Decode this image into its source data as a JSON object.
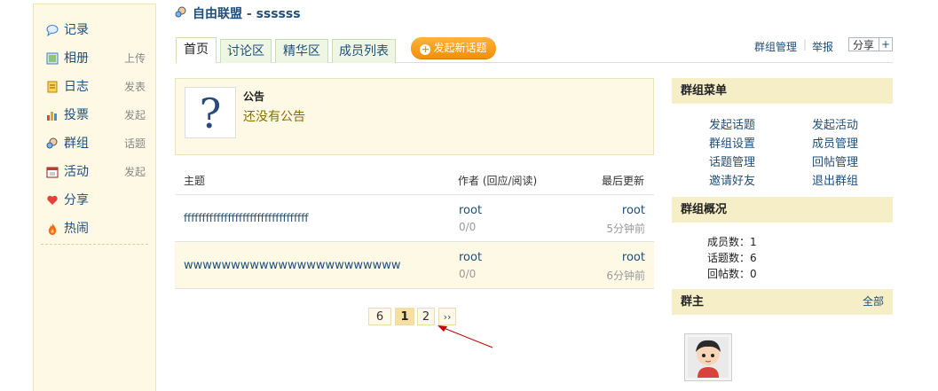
{
  "sidebar": {
    "items": [
      {
        "label": "记录",
        "action": "",
        "icon": "speech-bubble-icon"
      },
      {
        "label": "相册",
        "action": "上传",
        "icon": "photo-icon"
      },
      {
        "label": "日志",
        "action": "发表",
        "icon": "notebook-icon"
      },
      {
        "label": "投票",
        "action": "发起",
        "icon": "bar-chart-icon"
      },
      {
        "label": "群组",
        "action": "话题",
        "icon": "group-icon"
      },
      {
        "label": "活动",
        "action": "发起",
        "icon": "calendar-icon"
      },
      {
        "label": "分享",
        "action": "",
        "icon": "heart-icon"
      },
      {
        "label": "热闹",
        "action": "",
        "icon": "fire-icon"
      }
    ]
  },
  "header": {
    "group_name": "自由联盟",
    "separator": "-",
    "subtitle": "ssssss"
  },
  "tabs": [
    {
      "label": "首页",
      "active": true
    },
    {
      "label": "讨论区",
      "active": false
    },
    {
      "label": "精华区",
      "active": false
    },
    {
      "label": "成员列表",
      "active": false
    }
  ],
  "new_topic_label": "发起新话题",
  "top_links": {
    "manage": "群组管理",
    "report": "举报",
    "share": "分享",
    "share_plus": "+"
  },
  "announcement": {
    "title": "公告",
    "text": "还没有公告",
    "image_glyph": "?"
  },
  "topic_table": {
    "headers": {
      "subject": "主题",
      "author": "作者 (回应/阅读)",
      "last": "最后更新"
    },
    "rows": [
      {
        "subject": "ffffffffffffffffffffffffffffffffff",
        "author": "root",
        "stats": "0/0",
        "last_user": "root",
        "last_time": "5分钟前"
      },
      {
        "subject": "wwwwwwwwwwwwwwwwwwwwwww",
        "author": "root",
        "stats": "0/0",
        "last_user": "root",
        "last_time": "6分钟前"
      }
    ]
  },
  "pagination": {
    "pages": [
      "6",
      "1",
      "2",
      "››"
    ],
    "current": "1"
  },
  "right": {
    "menu_title": "群组菜单",
    "menu_links": [
      "发起话题",
      "发起活动",
      "群组设置",
      "成员管理",
      "话题管理",
      "回帖管理",
      "邀请好友",
      "退出群组"
    ],
    "overview_title": "群组概况",
    "stats": [
      {
        "label": "成员数：",
        "value": "1"
      },
      {
        "label": "话题数：",
        "value": "6"
      },
      {
        "label": "回帖数：",
        "value": "0"
      }
    ],
    "owner_title": "群主",
    "owner_all": "全部"
  },
  "colors": {
    "link": "#1f4e79",
    "accent": "#f58f08",
    "panel": "#fdf9e5",
    "arrow": "#c00000"
  }
}
